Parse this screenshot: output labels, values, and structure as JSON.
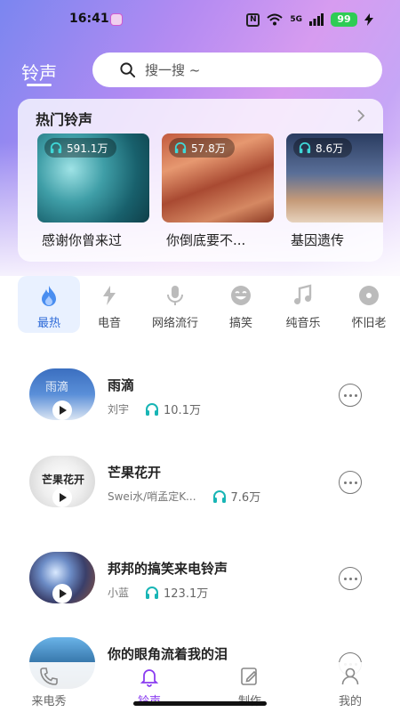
{
  "status_bar": {
    "time": "16:41",
    "network": "5G",
    "battery": "99"
  },
  "header": {
    "tab_label": "铃声",
    "search_placeholder": "搜一搜 ~"
  },
  "hot": {
    "title": "热门铃声",
    "items": [
      {
        "plays": "591.1万",
        "name": "感谢你曾来过"
      },
      {
        "plays": "57.8万",
        "name": "你倒底要不..."
      },
      {
        "plays": "8.6万",
        "name": "基因遗传"
      }
    ]
  },
  "categories": [
    {
      "label": "最热",
      "icon": "flame-icon"
    },
    {
      "label": "电音",
      "icon": "lightning-icon"
    },
    {
      "label": "网络流行",
      "icon": "microphone-icon"
    },
    {
      "label": "搞笑",
      "icon": "laugh-icon"
    },
    {
      "label": "纯音乐",
      "icon": "music-note-icon"
    },
    {
      "label": "怀旧老",
      "icon": "vinyl-icon"
    }
  ],
  "songs": [
    {
      "title": "雨滴",
      "artist": "刘宇",
      "plays": "10.1万"
    },
    {
      "title": "芒果花开",
      "artist": "Swei水/哨孟定K...",
      "plays": "7.6万"
    },
    {
      "title": "邦邦的搞笑来电铃声",
      "artist": "小蓝",
      "plays": "123.1万"
    },
    {
      "title": "你的眼角流着我的泪",
      "artist": "",
      "plays": ""
    }
  ],
  "cover_texts": {
    "song1": "雨滴",
    "song2": "芒果花开"
  },
  "bottom_nav": [
    {
      "label": "来电秀",
      "icon": "phone-icon"
    },
    {
      "label": "铃声",
      "icon": "bell-icon"
    },
    {
      "label": "制作",
      "icon": "edit-icon"
    },
    {
      "label": "我的",
      "icon": "user-icon"
    }
  ],
  "colors": {
    "accent": "#8a3cf0",
    "category_active": "#2f6bd8",
    "play_count_icon": "#18b5b5"
  }
}
